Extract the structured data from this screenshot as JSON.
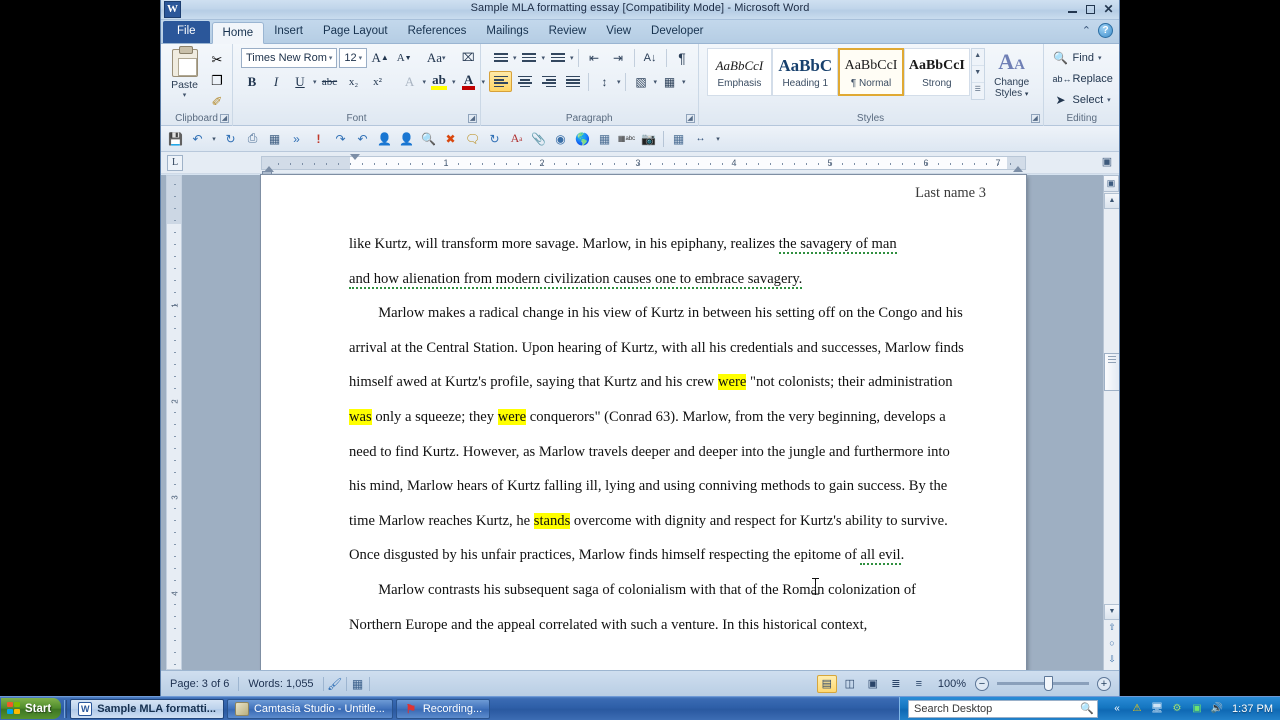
{
  "window": {
    "logo": "W",
    "title": "Sample MLA formatting essay [Compatibility Mode]  -  Microsoft Word",
    "minimize": "minimize-icon",
    "restore": "restore-icon",
    "close": "close-icon"
  },
  "tabs": [
    {
      "label": "File",
      "kind": "file"
    },
    {
      "label": "Home",
      "kind": "active"
    },
    {
      "label": "Insert",
      "kind": "normal"
    },
    {
      "label": "Page Layout",
      "kind": "normal"
    },
    {
      "label": "References",
      "kind": "normal"
    },
    {
      "label": "Mailings",
      "kind": "normal"
    },
    {
      "label": "Review",
      "kind": "normal"
    },
    {
      "label": "View",
      "kind": "normal"
    },
    {
      "label": "Developer",
      "kind": "normal"
    }
  ],
  "tabstrip_right": {
    "minimize_ribbon": "⌃",
    "help": "?"
  },
  "ribbon": {
    "clipboard": {
      "label": "Clipboard",
      "paste_label": "Paste",
      "paste_caret": "▾",
      "cut": "✂",
      "copy": "❐",
      "format_painter": "✐"
    },
    "font": {
      "label": "Font",
      "font_name": "Times New Rom",
      "font_size": "12",
      "grow_font": "A",
      "shrink_font": "A",
      "change_case": "Aa",
      "clear_formatting": "⌧",
      "bold": "B",
      "italic": "I",
      "underline": "U",
      "strikethrough": "abc",
      "subscript": "x₂",
      "superscript": "x²",
      "text_effects": "A",
      "highlight": "ab",
      "font_color": "A"
    },
    "paragraph": {
      "label": "Paragraph",
      "bullets": "☰",
      "numbering": "☰",
      "multilevel": "☰",
      "decrease_indent": "⇤",
      "increase_indent": "⇥",
      "sort": "A↓",
      "show_marks": "¶",
      "align_left": "≡",
      "align_center": "≡",
      "align_right": "≡",
      "justify": "≡",
      "line_spacing": "↕",
      "shading": "▧",
      "borders": "▦"
    },
    "styles": {
      "label": "Styles",
      "items": [
        {
          "preview": "AaBbCcI",
          "name": "Emphasis",
          "selected": false
        },
        {
          "preview": "AaBbC",
          "name": "Heading 1",
          "selected": false
        },
        {
          "preview": "AaBbCcI",
          "name": "¶ Normal",
          "selected": true
        },
        {
          "preview": "AaBbCcI",
          "name": "Strong",
          "selected": false
        }
      ],
      "change_styles_label_1": "Change",
      "change_styles_label_2": "Styles",
      "change_styles_caret": "▾"
    },
    "editing": {
      "label": "Editing",
      "find": "Find",
      "find_caret": "▾",
      "replace": "Replace",
      "select": "Select",
      "select_caret": "▾"
    }
  },
  "quick_access_toolbar": {
    "icons": [
      "save-icon",
      "undo-icon",
      "undo-dropdown-icon",
      "redo-icon",
      "print-preview-icon",
      "image-icon",
      "fast-forward-icon",
      "exclamation-icon",
      "redo-arrow-icon",
      "undo-arrow-icon",
      "person-green-icon",
      "person-dark-icon",
      "zoom-icon",
      "cancel-icon",
      "comment-icon",
      "refresh-icon",
      "superscript-a-icon",
      "paperclip-icon",
      "link-icon",
      "globe-icon",
      "grid-icon",
      "word-count-icon",
      "picture-frame-icon",
      "select-area-icon",
      "spacing-icon",
      "more-icon"
    ]
  },
  "ruler": {
    "tab_selector": "L",
    "numbers": [
      "1",
      "2",
      "3",
      "4",
      "5",
      "6",
      "7"
    ],
    "right_icon": "view-ruler-icon"
  },
  "vertical_ruler": {
    "numbers": [
      "1",
      "2",
      "3",
      "4"
    ]
  },
  "document": {
    "header_text": "Last name 3",
    "paragraphs": [
      {
        "id": "p1",
        "runs": [
          {
            "t": "like Kurtz, will transform more savage.  Marlow, in his epiphany, realizes ",
            "style": "plain"
          },
          {
            "t": "the savagery of man",
            "style": "squiggle"
          }
        ]
      },
      {
        "id": "p2",
        "runs": [
          {
            "t": "and how alienation from modern civilization causes one to embrace savagery.",
            "style": "squiggle"
          }
        ]
      },
      {
        "id": "p3",
        "runs": [
          {
            "t": "        Marlow makes a radical change in his view of Kurtz in between his setting off on the Congo and his arrival at the Central Station. Upon hearing of Kurtz, with all his credentials and successes, Marlow finds himself awed at Kurtz's profile, saying that Kurtz and his crew ",
            "style": "plain"
          },
          {
            "t": "were",
            "style": "highlight"
          },
          {
            "t": " \"not colonists; their administration ",
            "style": "plain"
          },
          {
            "t": "was",
            "style": "highlight"
          },
          {
            "t": " only a squeeze; they ",
            "style": "plain"
          },
          {
            "t": "were",
            "style": "highlight"
          },
          {
            "t": " conquerors\" (Conrad 63).  Marlow, from the very beginning, develops a need to find Kurtz.  However, as Marlow travels deeper and deeper into the jungle and furthermore into his mind, Marlow hears of Kurtz falling ill, lying and using conniving methods to gain success.  By the time Marlow reaches Kurtz, he ",
            "style": "plain"
          },
          {
            "t": "stands",
            "style": "highlight"
          },
          {
            "t": " overcome with dignity and respect for Kurtz's ability to survive.  Once disgusted by his unfair practices, Marlow finds himself respecting the epitome of ",
            "style": "plain"
          },
          {
            "t": "all evil",
            "style": "squiggle"
          },
          {
            "t": ".",
            "style": "plain"
          }
        ]
      },
      {
        "id": "p4",
        "runs": [
          {
            "t": "        Marlow contrasts his subsequent saga of colonialism with that of the Roman colonization of Northern Europe and the appeal correlated with such a venture. In this historical context,",
            "style": "plain"
          }
        ]
      }
    ],
    "highlight_color": "#ffff00",
    "squiggle_color": "#2f8f3f"
  },
  "status_bar": {
    "page": "Page: 3 of 6",
    "words": "Words: 1,055",
    "proofing_icon": "spellcheck-icon",
    "language_icon": "language-icon",
    "views": [
      {
        "name": "print-layout-view-icon",
        "glyph": "▤",
        "selected": true
      },
      {
        "name": "full-screen-reading-view-icon",
        "glyph": "◫",
        "selected": false
      },
      {
        "name": "web-layout-view-icon",
        "glyph": "▣",
        "selected": false
      },
      {
        "name": "outline-view-icon",
        "glyph": "≣",
        "selected": false
      },
      {
        "name": "draft-view-icon",
        "glyph": "≡",
        "selected": false
      }
    ],
    "zoom_level": "100%",
    "zoom_out": "−",
    "zoom_in": "+"
  },
  "taskbar": {
    "start_label": "Start",
    "buttons": [
      {
        "label": "Sample MLA formatti...",
        "icon": "word-icon",
        "active": true
      },
      {
        "label": "Camtasia Studio - Untitle...",
        "icon": "camtasia-icon",
        "active": false
      },
      {
        "label": "Recording...",
        "icon": "recording-icon",
        "active": false
      }
    ],
    "search_placeholder": "Search Desktop",
    "search_value": "",
    "search_icon": "search-icon",
    "tray_icons": [
      "show-hidden-icons-icon",
      "security-shield-icon",
      "display-icon",
      "antivirus-icon",
      "network-icon",
      "sound-icon"
    ],
    "clock": "1:37 PM"
  }
}
